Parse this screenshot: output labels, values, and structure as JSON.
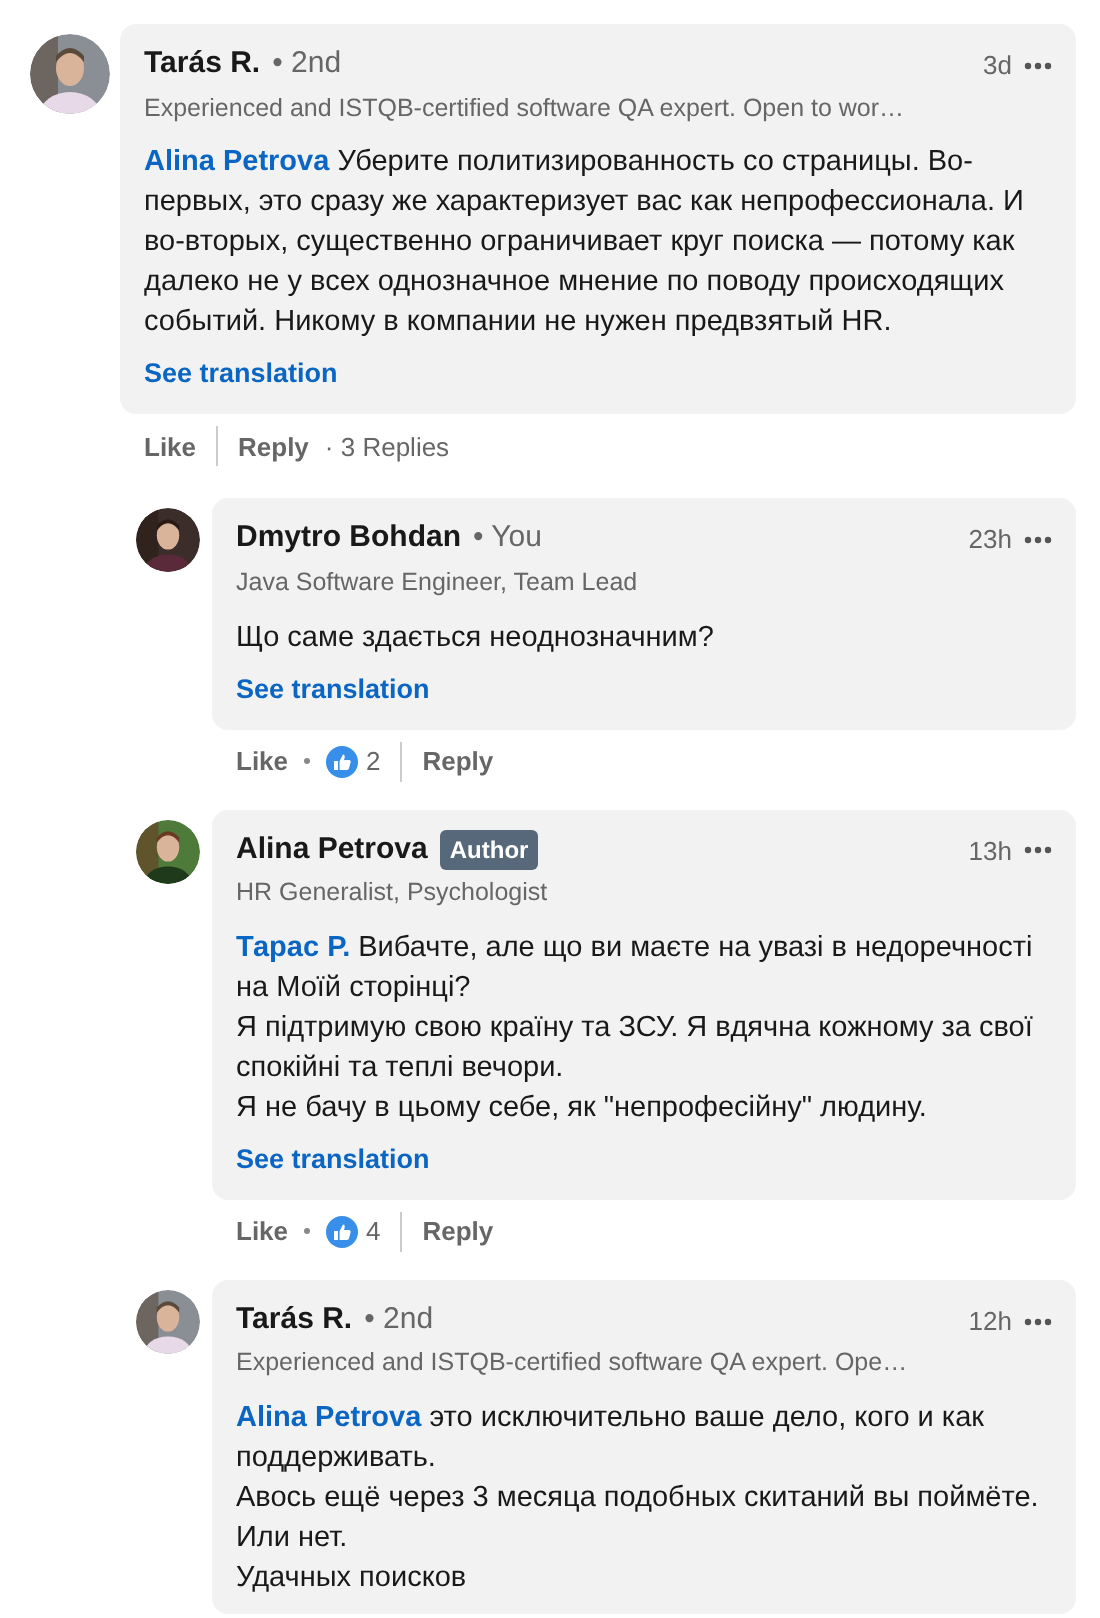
{
  "comment": {
    "author": "Tarás R.",
    "degree": "• 2nd",
    "headline": "Experienced and ISTQB-certified software QA expert. Open to wor…",
    "time": "3d",
    "mention": "Alina Petrova",
    "body": "Уберите политизированность со страницы. Во-первых, это сразу же характеризует вас как непрофессионала. И во-вторых, существенно ограничивает круг поиска — потому как далеко не у всех однозначное мнение по поводу происходящих событий. Никому в компании не нужен предвзятый HR.",
    "see_translation": "See translation",
    "actions": {
      "like": "Like",
      "reply": "Reply",
      "replies": "· 3 Replies"
    },
    "children": [
      {
        "author": "Dmytro Bohdan",
        "degree": "• You",
        "headline": "Java Software Engineer, Team Lead",
        "time": "23h",
        "body": "Що саме здається неоднозначним?",
        "see_translation": "See translation",
        "actions": {
          "like": "Like",
          "reactions": "2",
          "reply": "Reply"
        }
      },
      {
        "author": "Alina Petrova",
        "badge": "Author",
        "headline": "HR Generalist, Psychologist",
        "time": "13h",
        "mention": "Тарас Р.",
        "body": "Вибачте, але що ви маєте на увазі в недоречності на Моїй сторінці?\nЯ підтримую свою країну та ЗСУ. Я вдячна кожному за свої спокійні та теплі вечори.\nЯ не бачу в цьому себе, як \"непрофесійну\" людину.",
        "see_translation": "See translation",
        "actions": {
          "like": "Like",
          "reactions": "4",
          "reply": "Reply"
        }
      },
      {
        "author": "Tarás R.",
        "degree": "• 2nd",
        "headline": "Experienced and ISTQB-certified software QA expert. Ope…",
        "time": "12h",
        "mention": "Alina Petrova",
        "body": "это исключительно ваше дело, кого и как поддерживать.\nАвось ещё через 3 месяца подобных скитаний вы поймёте. Или нет.\nУдачных поисков"
      }
    ]
  }
}
